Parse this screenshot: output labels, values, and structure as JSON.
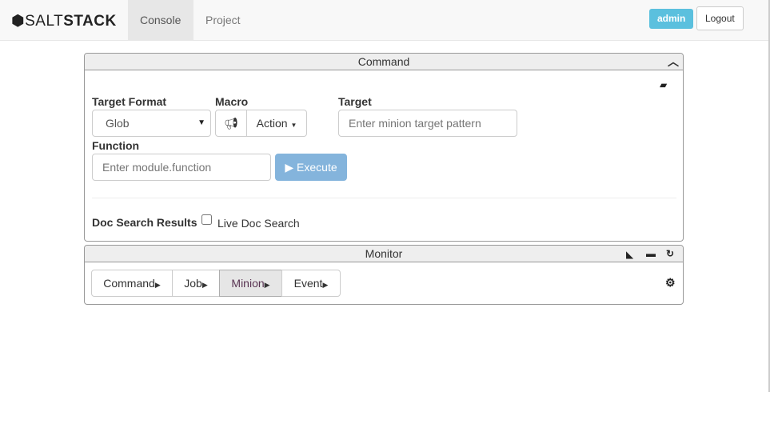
{
  "nav": {
    "logo_light": "SALT",
    "logo_bold": "STACK",
    "tabs": [
      "Console",
      "Project"
    ],
    "user": "admin",
    "logout": "Logout"
  },
  "command": {
    "title": "Command",
    "target_format_label": "Target Format",
    "target_format_value": "Glob",
    "macro_label": "Macro",
    "action_label": "Action",
    "target_label": "Target",
    "target_placeholder": "Enter minion target pattern",
    "function_label": "Function",
    "function_placeholder": "Enter module.function",
    "execute_label": "Execute",
    "doc_search_label": "Doc Search Results",
    "live_doc_search_label": "Live Doc Search",
    "execute_color": "#84b4dc"
  },
  "monitor": {
    "title": "Monitor",
    "tabs": [
      "Command",
      "Job",
      "Minion",
      "Event"
    ],
    "active_tab": "Minion"
  }
}
